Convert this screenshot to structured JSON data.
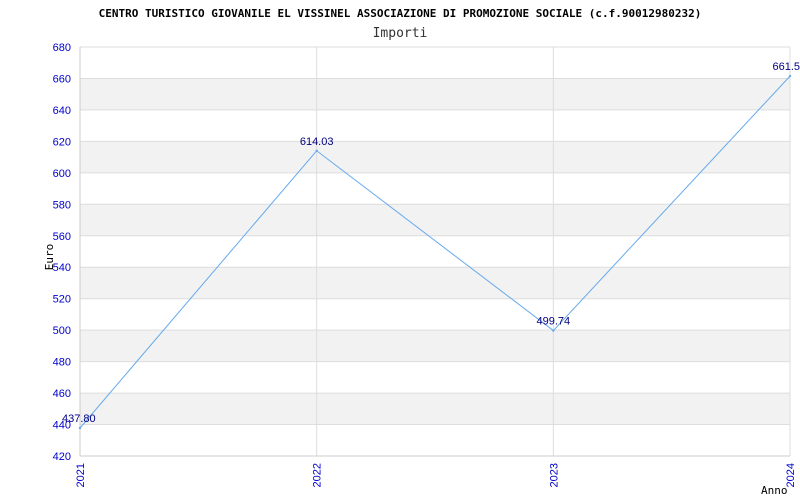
{
  "chart_data": {
    "type": "line",
    "title": "CENTRO TURISTICO GIOVANILE EL VISSINEL ASSOCIAZIONE DI PROMOZIONE SOCIALE (c.f.90012980232)",
    "subtitle": "Importi",
    "xlabel": "Anno",
    "ylabel": "Euro",
    "categories": [
      "2021",
      "2022",
      "2023",
      "2024"
    ],
    "series": [
      {
        "values": [
          437.8,
          614.03,
          499.74,
          661.5
        ]
      }
    ],
    "data_labels": [
      "437.80",
      "614.03",
      "499.74",
      "661.5"
    ],
    "ylim": [
      420,
      680
    ],
    "yticks": [
      420,
      440,
      460,
      480,
      500,
      520,
      540,
      560,
      580,
      600,
      620,
      640,
      660,
      680
    ],
    "grid": true,
    "band_colors": [
      "#ffffff",
      "#f2f2f2"
    ],
    "line_color": "#66aaee",
    "tick_color": "#0000cc",
    "label_color": "#000080"
  }
}
